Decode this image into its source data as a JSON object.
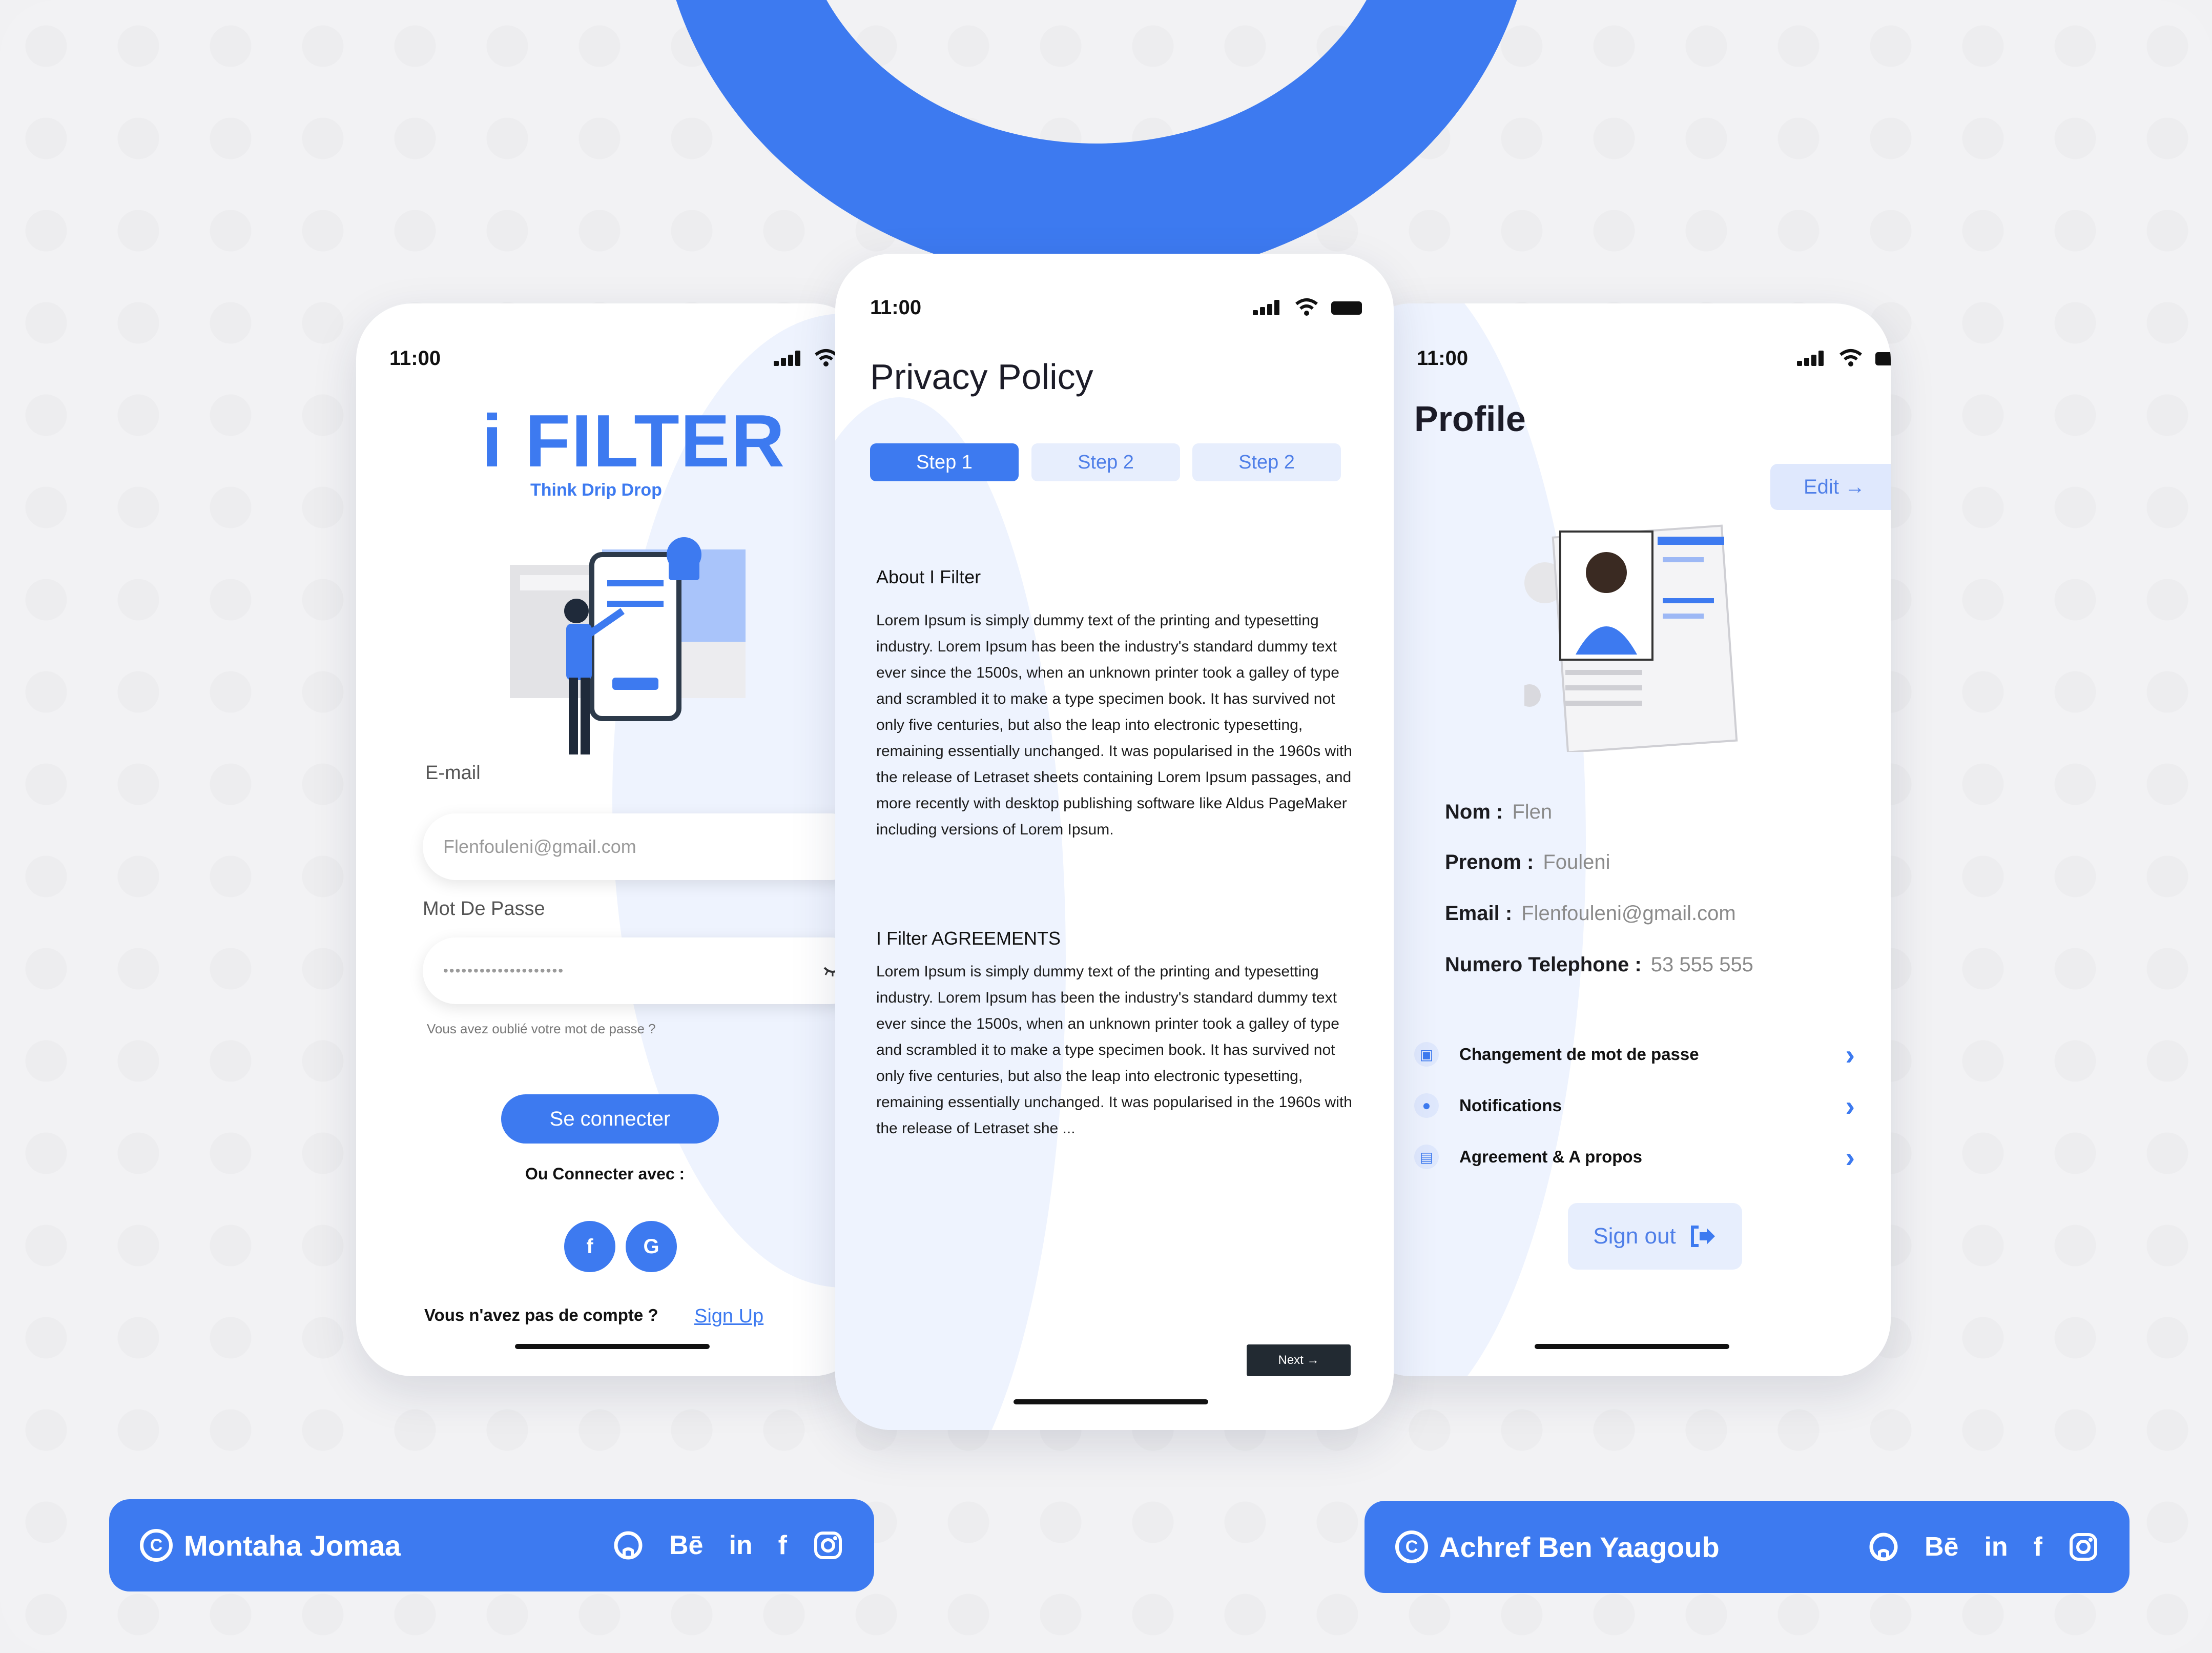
{
  "colors": {
    "accent": "#3d7af0",
    "accent_light": "#e7eefd",
    "background": "#f2f2f4"
  },
  "login": {
    "time": "11:00",
    "brand": "i FILTER",
    "tagline": "Think Drip Drop",
    "email_label": "E-mail",
    "email_value": "Flenfouleni@gmail.com",
    "password_label": "Mot De Passe",
    "password_value": "••••••••••••••••••••",
    "forgot": "Vous avez oublié votre mot de passe ?",
    "connect_btn": "Se connecter",
    "or_connect": "Ou Connecter avec :",
    "social_facebook": "f",
    "social_google": "G",
    "no_account": "Vous n'avez pas de compte ?",
    "signup": "Sign Up"
  },
  "privacy": {
    "time": "11:00",
    "title": "Privacy Policy",
    "steps": [
      "Step 1",
      "Step 2",
      "Step 2"
    ],
    "about_title": "About I Filter",
    "about_text": "Lorem Ipsum is simply dummy text of the printing and typesetting industry. Lorem Ipsum has been the industry's standard dummy text ever since the 1500s, when an unknown printer took a galley of type and scrambled it to make a type specimen book. It has survived not only five centuries, but also the leap into electronic typesetting, remaining essentially unchanged. It was popularised in the 1960s with the release of Letraset sheets containing Lorem Ipsum passages, and more recently with desktop publishing software like Aldus PageMaker including versions of Lorem Ipsum.",
    "agreements_title": "I Filter AGREEMENTS",
    "agreements_text": "Lorem Ipsum is simply dummy text of the printing and typesetting industry. Lorem Ipsum has been the industry's standard dummy text ever since the 1500s, when an unknown printer took a galley of type and scrambled it to make a type specimen book. It has survived not only five centuries, but also the leap into electronic typesetting, remaining essentially unchanged. It was popularised in the 1960s with the release of Letraset she ...",
    "next": "Next →"
  },
  "profile": {
    "time": "11:00",
    "title": "Profile",
    "edit": "Edit →",
    "fields": [
      {
        "key": "Nom :",
        "value": "Flen"
      },
      {
        "key": "Prenom :",
        "value": "Fouleni"
      },
      {
        "key": "Email :",
        "value": "Flenfouleni@gmail.com"
      },
      {
        "key": "Numero Telephone :",
        "value": "53 555 555"
      }
    ],
    "menu": [
      {
        "label": "Changement de mot de passe",
        "icon": "lock-icon"
      },
      {
        "label": "Notifications",
        "icon": "bell-icon"
      },
      {
        "label": "Agreement & A propos",
        "icon": "document-icon"
      }
    ],
    "signout": "Sign out"
  },
  "credits": [
    {
      "name": "Montaha Jomaa",
      "icons": [
        "github-icon",
        "behance-icon",
        "linkedin-icon",
        "facebook-icon",
        "instagram-icon"
      ]
    },
    {
      "name": "Achref Ben Yaagoub",
      "icons": [
        "github-icon",
        "behance-icon",
        "linkedin-icon",
        "facebook-icon",
        "instagram-icon"
      ]
    }
  ],
  "icon_glyphs": {
    "copyright": "C",
    "behance": "Bē",
    "linkedin": "in",
    "facebook": "f"
  }
}
